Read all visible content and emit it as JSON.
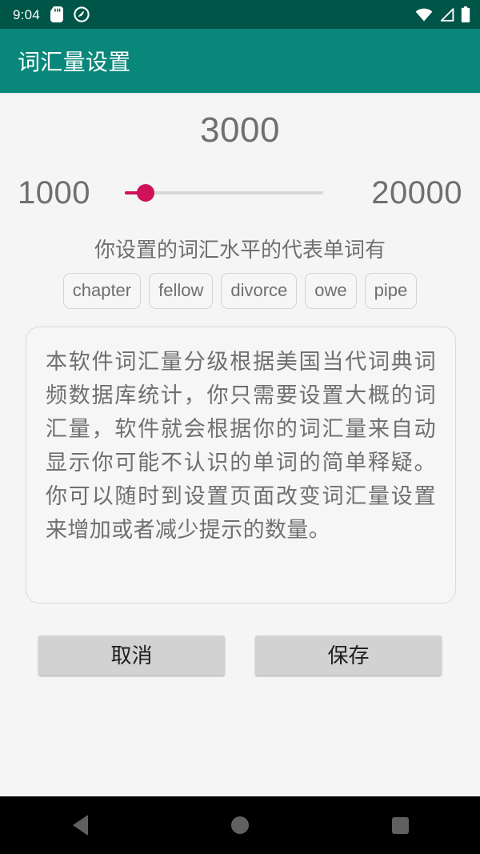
{
  "status_bar": {
    "time": "9:04",
    "icons_left": [
      "sd-card-icon",
      "do-not-disturb-icon"
    ],
    "icons_right": [
      "wifi-icon",
      "cellular-signal-icon",
      "battery-icon"
    ],
    "background_color": "#005549"
  },
  "app_bar": {
    "title": "词汇量设置",
    "background_color": "#08877a",
    "title_color": "#ffffff"
  },
  "slider": {
    "value": "3000",
    "min_label": "1000",
    "max_label": "20000",
    "min": 1000,
    "max": 20000,
    "current": 3000,
    "accent_color": "#cf1259",
    "track_color": "#d8d8d8"
  },
  "helper_text": "你设置的词汇水平的代表单词有",
  "sample_words": [
    {
      "label": "chapter"
    },
    {
      "label": "fellow"
    },
    {
      "label": "divorce"
    },
    {
      "label": "owe"
    },
    {
      "label": "pipe"
    }
  ],
  "description": {
    "text": "本软件词汇量分级根据美国当代词典词频数据库统计，你只需要设置大概的词汇量，软件就会根据你的词汇量来自动显示你可能不认识的单词的简单释疑。你可以随时到设置页面改变词汇量设置来增加或者减少提示的数量。"
  },
  "buttons": {
    "cancel_label": "取消",
    "save_label": "保存",
    "background_color": "#d2d2d2"
  },
  "nav_bar": {
    "back": "back-icon",
    "home": "home-icon",
    "recents": "recents-icon",
    "background_color": "#000000"
  },
  "page_background": "#f5f5f5"
}
